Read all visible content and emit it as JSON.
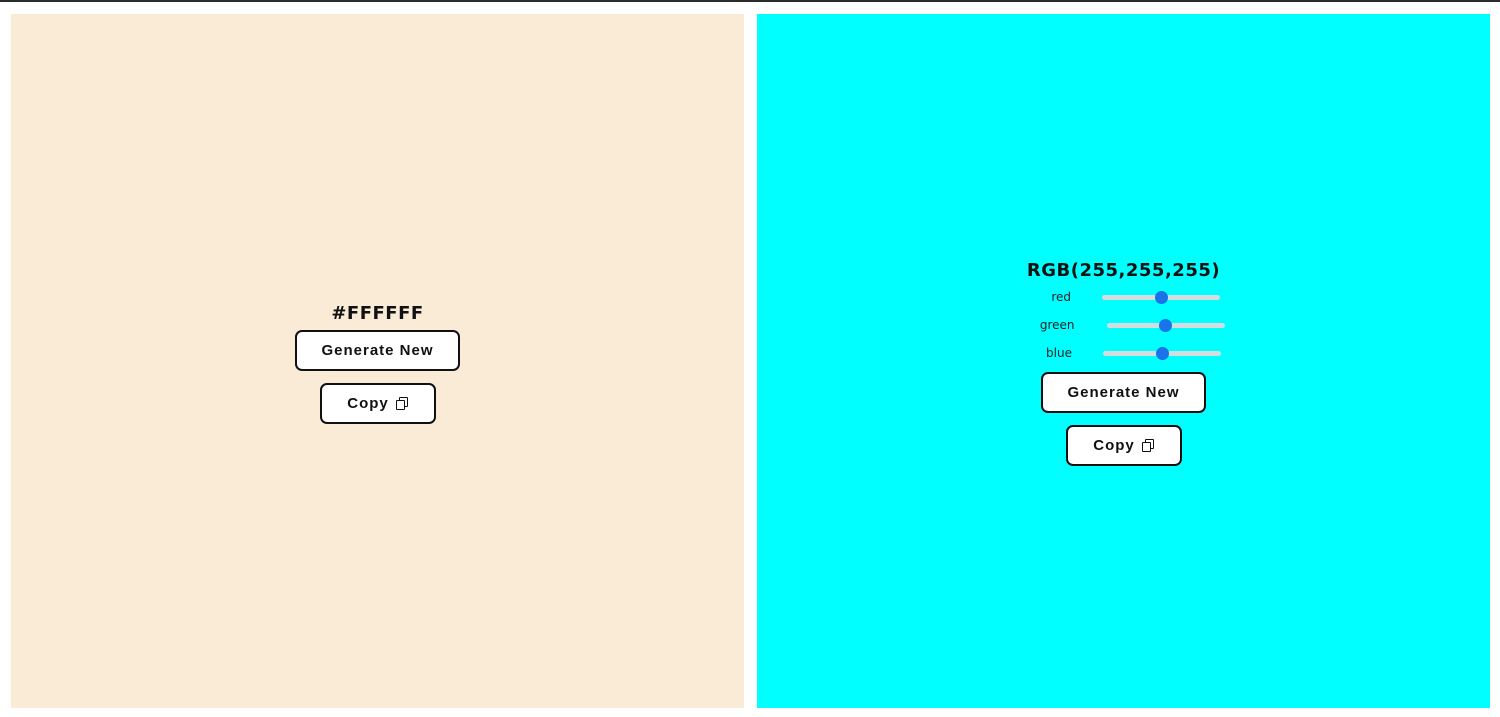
{
  "hex_panel": {
    "background": "#FAEBD7",
    "color_code": "#FFFFFF",
    "generate_label": "Generate New",
    "copy_label": "Copy"
  },
  "rgb_panel": {
    "background": "#00FFFF",
    "color_code": "RGB(255,255,255)",
    "sliders": [
      {
        "label": "red",
        "value": 0.5
      },
      {
        "label": "green",
        "value": 0.5
      },
      {
        "label": "blue",
        "value": 0.5
      }
    ],
    "generate_label": "Generate New",
    "copy_label": "Copy"
  },
  "icons": {
    "copy": "copy-icon"
  }
}
